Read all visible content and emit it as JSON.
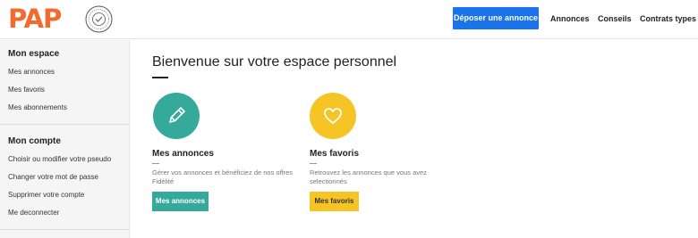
{
  "header": {
    "logo": "PAP",
    "seal_icon": "certified-seal-icon",
    "cta_label": "Déposer une annonce",
    "nav": [
      "Annonces",
      "Conseils",
      "Contrats types"
    ]
  },
  "sidebar": {
    "sections": [
      {
        "title": "Mon espace",
        "items": [
          "Mes annonces",
          "Mes favoris",
          "Mes abonnements"
        ]
      },
      {
        "title": "Mon compte",
        "items": [
          "Choisir ou modifier votre pseudo",
          "Changer votre mot de passe",
          "Supprimer votre compte",
          "Me deconnecter"
        ]
      }
    ]
  },
  "main": {
    "title": "Bienvenue sur votre espace personnel",
    "cards": [
      {
        "icon": "pencil-icon",
        "title": "Mes annonces",
        "description": "Gérer vos annonces et bénéficiez de nos offres Fidélité",
        "button": "Mes annonces",
        "color": "#35a99a"
      },
      {
        "icon": "heart-icon",
        "title": "Mes favoris",
        "description": "Retrouvez les annonces que vous avez selectionnés",
        "button": "Mes favoris",
        "color": "#f7c425"
      }
    ]
  },
  "colors": {
    "brand": "#f26a2e",
    "cta": "#1a73e8",
    "teal": "#35a99a",
    "yellow": "#f7c425"
  }
}
